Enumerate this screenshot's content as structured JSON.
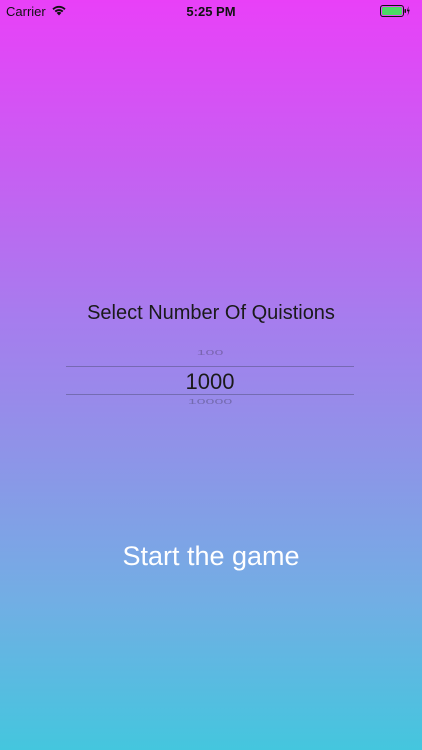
{
  "status_bar": {
    "carrier": "Carrier",
    "time": "5:25 PM",
    "wifi_icon": "wifi-icon",
    "battery_icon": "battery-icon",
    "charging_icon": "bolt-icon",
    "battery_level": 1.0,
    "battery_color": "#4cd964"
  },
  "main": {
    "title": "Select Number Of Quistions",
    "picker": {
      "options": [
        "100",
        "1000",
        "10000"
      ],
      "selected": "1000"
    },
    "start_button_label": "Start the game"
  },
  "colors": {
    "gradient_top": "#e940f8",
    "gradient_bottom": "#44c6de",
    "text": "#1a1a1a",
    "button_text": "#ffffff"
  }
}
